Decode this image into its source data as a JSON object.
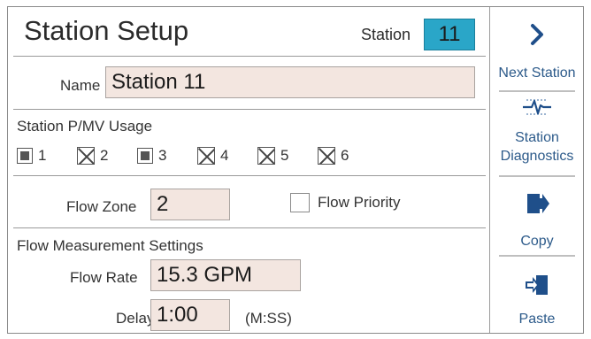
{
  "header": {
    "title": "Station Setup",
    "station_label": "Station",
    "station_number": "11"
  },
  "name_field": {
    "label": "Name",
    "value": "Station 11"
  },
  "pmv_usage": {
    "title": "Station P/MV Usage",
    "items": [
      {
        "label": "1",
        "state": "selected"
      },
      {
        "label": "2",
        "state": "unavailable"
      },
      {
        "label": "3",
        "state": "selected"
      },
      {
        "label": "4",
        "state": "unavailable"
      },
      {
        "label": "5",
        "state": "unavailable"
      },
      {
        "label": "6",
        "state": "unavailable"
      }
    ]
  },
  "flow_zone": {
    "label": "Flow Zone",
    "value": "2",
    "priority_label": "Flow Priority",
    "priority_checked": false
  },
  "flow_measurement": {
    "title": "Flow Measurement Settings",
    "rate_label": "Flow Rate",
    "rate_value": "15.3 GPM",
    "delay_label": "Delay",
    "delay_value": "1:00",
    "delay_unit": "(M:SS)"
  },
  "sidebar": {
    "next_station": "Next Station",
    "diagnostics_line1": "Station",
    "diagnostics_line2": "Diagnostics",
    "copy": "Copy",
    "paste": "Paste"
  },
  "colors": {
    "station_box": "#2aa6c8",
    "input_bg": "#f3e6e0",
    "sidebar_text": "#2c5a8a",
    "sidebar_icon": "#1f4f8a"
  },
  "icons": [
    "chevron-right-icon",
    "heartbeat-icon",
    "copy-arrow-icon",
    "paste-arrow-icon"
  ]
}
